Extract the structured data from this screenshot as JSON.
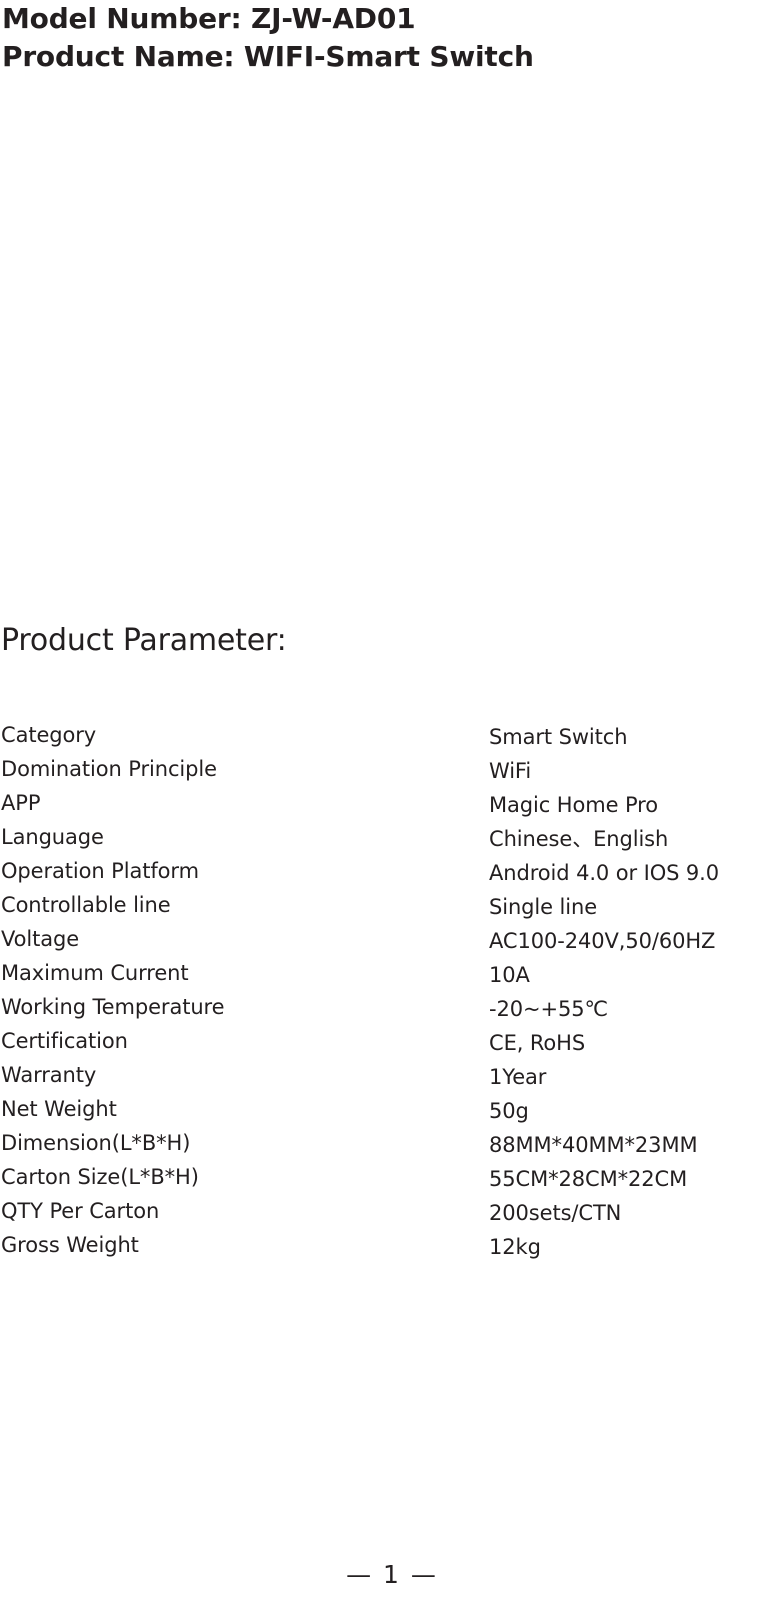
{
  "header": {
    "lines": [
      "Model Number: ZJ-W-AD01",
      "Product Name: WIFI-Smart Switch"
    ]
  },
  "section": {
    "heading": "Product Parameter:"
  },
  "parameters": {
    "rows": [
      {
        "label": "Category",
        "value": "Smart Switch"
      },
      {
        "label": "Domination Principle",
        "value": "WiFi"
      },
      {
        "label": "APP",
        "value": "Magic Home Pro"
      },
      {
        "label": "Language",
        "value": "Chinese、English"
      },
      {
        "label": "Operation Platform",
        "value": "Android 4.0 or IOS 9.0"
      },
      {
        "label": "Controllable line",
        "value": "Single line"
      },
      {
        "label": "Voltage",
        "value": "AC100-240V,50/60HZ"
      },
      {
        "label": "Maximum Current",
        "value": "10A"
      },
      {
        "label": "Working Temperature",
        "value": "-20~+55℃"
      },
      {
        "label": "Certification",
        "value": "CE, RoHS"
      },
      {
        "label": "Warranty",
        "value": "1Year"
      },
      {
        "label": "Net Weight",
        "value": "50g"
      },
      {
        "label": "Dimension(L*B*H)",
        "value": "88MM*40MM*23MM"
      },
      {
        "label": "Carton Size(L*B*H)",
        "value": "55CM*28CM*22CM"
      },
      {
        "label": "QTY Per Carton",
        "value": "200sets/CTN"
      },
      {
        "label": "Gross Weight",
        "value": "12kg"
      }
    ]
  },
  "footer": {
    "page_marker": "— 1 —"
  },
  "colors": {
    "text": "#231f20",
    "background": "#ffffff"
  }
}
